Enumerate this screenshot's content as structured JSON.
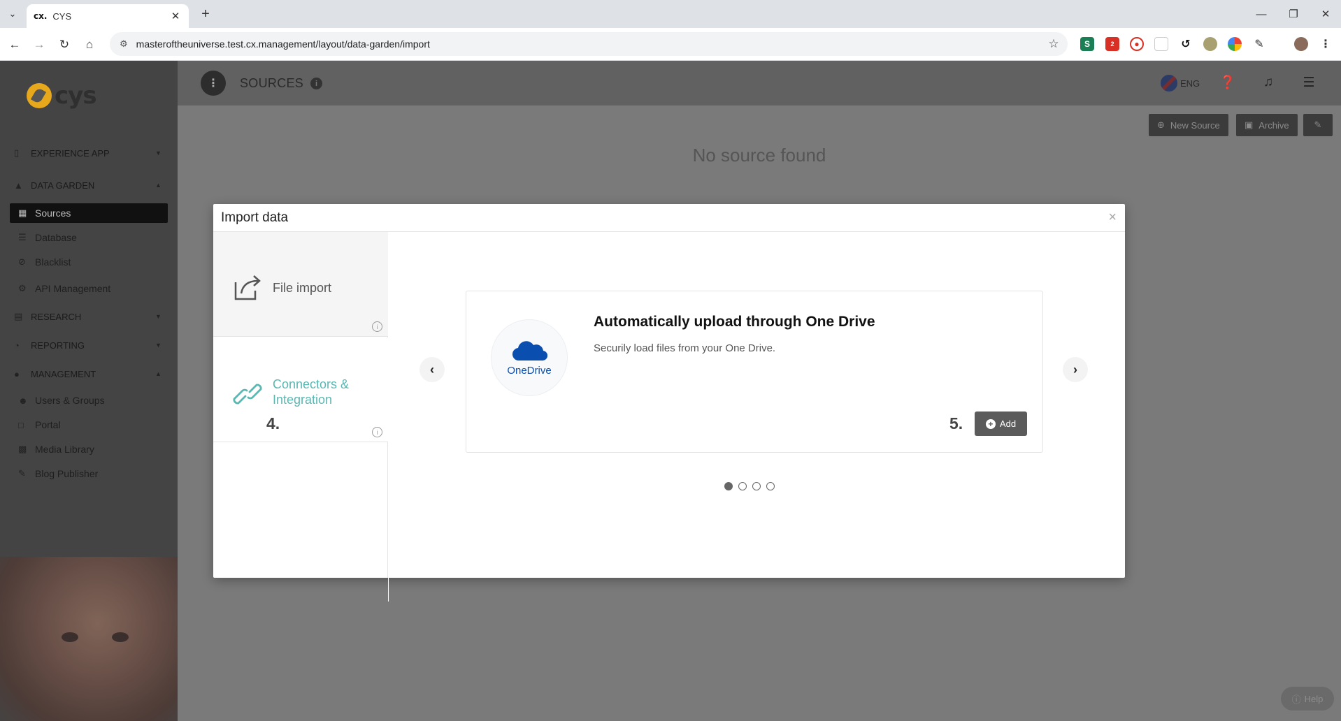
{
  "browser": {
    "tab_favicon": "cx.",
    "tab_title": "CYS",
    "url": "masteroftheuniverse.test.cx.management/layout/data-garden/import",
    "icons": [
      "tab-list-icon",
      "close-icon",
      "plus-icon",
      "back-icon",
      "forward-icon",
      "reload-icon",
      "home-icon",
      "site-settings-icon",
      "star-icon",
      "extensions-icon",
      "profile-avatar",
      "menu-icon"
    ],
    "extension_badge": "2"
  },
  "sidebar": {
    "logo_text": "cys",
    "sections": [
      {
        "label": "EXPERIENCE APP",
        "icon": "mobile-icon"
      },
      {
        "label": "DATA GARDEN",
        "icon": "tree-icon"
      },
      {
        "label": "RESEARCH",
        "icon": "inbox-icon"
      },
      {
        "label": "REPORTING",
        "icon": "pie-chart-icon"
      },
      {
        "label": "MANAGEMENT",
        "icon": "user-icon"
      }
    ],
    "data_garden_items": [
      {
        "label": "Sources",
        "icon": "sources-icon",
        "active": true
      },
      {
        "label": "Database",
        "icon": "database-icon"
      },
      {
        "label": "Blacklist",
        "icon": "ban-icon"
      },
      {
        "label": "API Management",
        "icon": "gear-icon"
      }
    ],
    "management_items": [
      {
        "label": "Users & Groups",
        "icon": "users-icon"
      },
      {
        "label": "Portal",
        "icon": "monitor-icon"
      },
      {
        "label": "Media Library",
        "icon": "image-icon"
      },
      {
        "label": "Blog Publisher",
        "icon": "pen-icon"
      }
    ]
  },
  "topbar": {
    "title": "SOURCES",
    "lang": "ENG"
  },
  "main": {
    "buttons": {
      "new_source": "New Source",
      "archive": "Archive"
    },
    "empty_text": "No source found",
    "help": "Help"
  },
  "modal": {
    "title": "Import data",
    "options": [
      {
        "label": "File import",
        "icon": "share-box-icon"
      },
      {
        "label": "Connectors & Integration",
        "icon": "link-icon"
      }
    ],
    "step_left": "4.",
    "card": {
      "logo_text": "OneDrive",
      "title": "Automatically upload through One Drive",
      "description": "Securily load files from your One Drive.",
      "step": "5.",
      "add_label": "Add"
    },
    "carousel": {
      "count": 4,
      "active": 0
    }
  },
  "colors": {
    "accent_teal": "#5ab7b2",
    "onedrive_blue": "#0a4fb0",
    "overlay_gray": "#7a7a7a"
  }
}
